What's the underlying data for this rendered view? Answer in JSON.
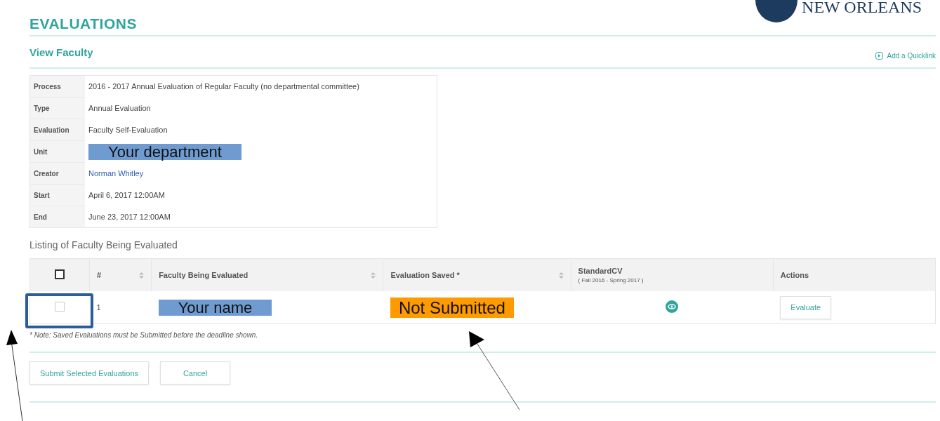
{
  "logo": {
    "text": "NEW ORLEANS"
  },
  "page_title": "EVALUATIONS",
  "section_title": "View Faculty",
  "quicklink": "Add a Quicklink",
  "details": [
    {
      "label": "Process",
      "value": "2016 - 2017 Annual Evaluation of Regular Faculty (no departmental committee)",
      "kind": "text"
    },
    {
      "label": "Type",
      "value": "Annual Evaluation",
      "kind": "text"
    },
    {
      "label": "Evaluation",
      "value": "Faculty Self-Evaluation",
      "kind": "text"
    },
    {
      "label": "Unit",
      "value": "Your department",
      "kind": "highlight"
    },
    {
      "label": "Creator",
      "value": "Norman Whitley",
      "kind": "link"
    },
    {
      "label": "Start",
      "value": "April 6, 2017 12:00AM",
      "kind": "text"
    },
    {
      "label": "End",
      "value": "June 23, 2017 12:00AM",
      "kind": "text"
    }
  ],
  "listing_title": "Listing of Faculty Being Evaluated",
  "table": {
    "select_all_checked": false,
    "columns": [
      {
        "label": "#",
        "sortable": true
      },
      {
        "label": "Faculty Being Evaluated",
        "sortable": true
      },
      {
        "label": "Evaluation Saved *",
        "sortable": true
      },
      {
        "label": "StandardCV",
        "sublabel": "( Fall 2016 - Spring 2017 )",
        "sortable": false
      },
      {
        "label": "Actions",
        "sortable": false
      }
    ],
    "rows": [
      {
        "checked": false,
        "number": "1",
        "name": "Your name",
        "status": "Not Submitted",
        "action": "Evaluate"
      }
    ]
  },
  "note": "* Note: Saved Evaluations must be Submitted before the deadline shown.",
  "buttons": [
    "Submit Selected Evaluations",
    "Cancel"
  ]
}
